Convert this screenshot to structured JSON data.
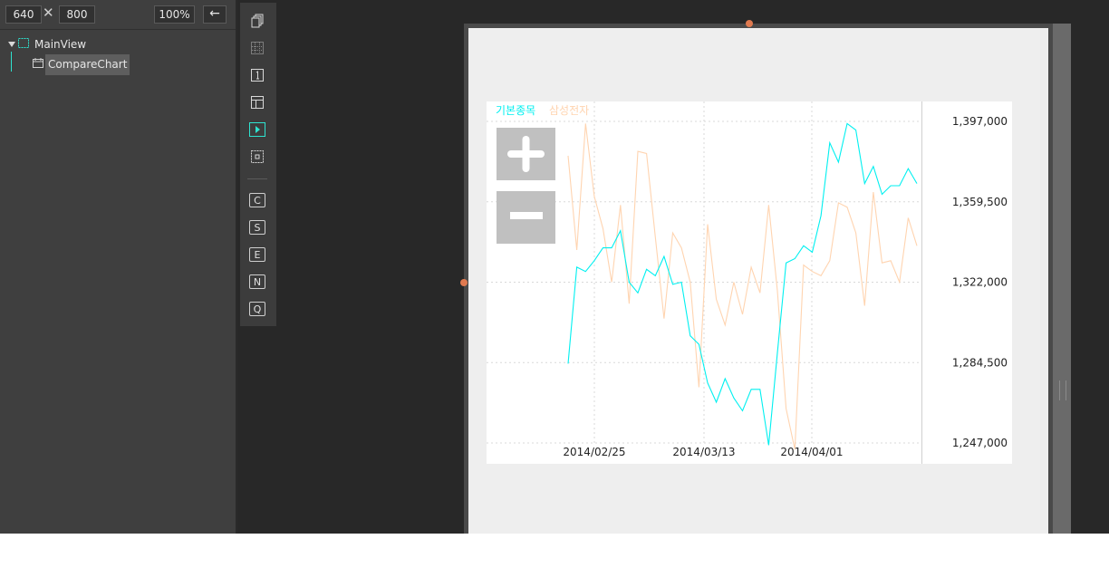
{
  "header": {
    "width_value": "640",
    "height_value": "800",
    "times_sign": "✕",
    "zoom": "100%",
    "back_arrow": "←"
  },
  "tree": {
    "items": [
      {
        "label": "MainView",
        "icon": "view-icon"
      },
      {
        "label": "CompareChart",
        "icon": "chart-component-icon",
        "selected": true
      }
    ]
  },
  "toolbar": {
    "icons": [
      "layers-icon",
      "grid-icon",
      "number-one-icon",
      "layout-icon",
      "play-icon",
      "select-box-icon"
    ],
    "letters": [
      "C",
      "S",
      "E",
      "N",
      "Q"
    ]
  },
  "colors": {
    "accent": "#2ee3d0",
    "series_base": "#00f0f0",
    "series_compare": "#ffd4b0",
    "grid": "#d8d8d8"
  },
  "chart_data": {
    "type": "line",
    "legend": [
      "기본종목",
      "삼성전자"
    ],
    "y_ticks": [
      "1,397,000",
      "1,359,500",
      "1,322,000",
      "1,284,500",
      "1,247,000"
    ],
    "ylim": [
      1247000,
      1397000
    ],
    "x_ticks": [
      "2014/02/25",
      "2014/03/13",
      "2014/04/01"
    ],
    "series": [
      {
        "name": "기본종목",
        "color": "#00f0f0",
        "values": [
          1284000,
          1329000,
          1327000,
          1332000,
          1338000,
          1338000,
          1346000,
          1322000,
          1317000,
          1328000,
          1325000,
          1334000,
          1321000,
          1322000,
          1297000,
          1293000,
          1275000,
          1266000,
          1277000,
          1268000,
          1262000,
          1272000,
          1272000,
          1246000,
          1289000,
          1331000,
          1333000,
          1339000,
          1336000,
          1353000,
          1387000,
          1378000,
          1396000,
          1393000,
          1368000,
          1376000,
          1363000,
          1367000,
          1367000,
          1375000,
          1368000
        ]
      },
      {
        "name": "삼성전자",
        "color": "#ffd4b0",
        "values": [
          1381000,
          1337000,
          1396000,
          1362000,
          1347000,
          1322000,
          1358000,
          1312000,
          1383000,
          1382000,
          1343000,
          1305000,
          1345000,
          1338000,
          1322000,
          1273000,
          1349000,
          1314000,
          1302000,
          1322000,
          1307000,
          1329000,
          1317000,
          1358000,
          1318000,
          1263000,
          1244000,
          1330000,
          1327000,
          1325000,
          1332000,
          1359000,
          1357000,
          1345000,
          1311000,
          1364000,
          1331000,
          1332000,
          1322000,
          1352000,
          1339000
        ]
      }
    ]
  }
}
